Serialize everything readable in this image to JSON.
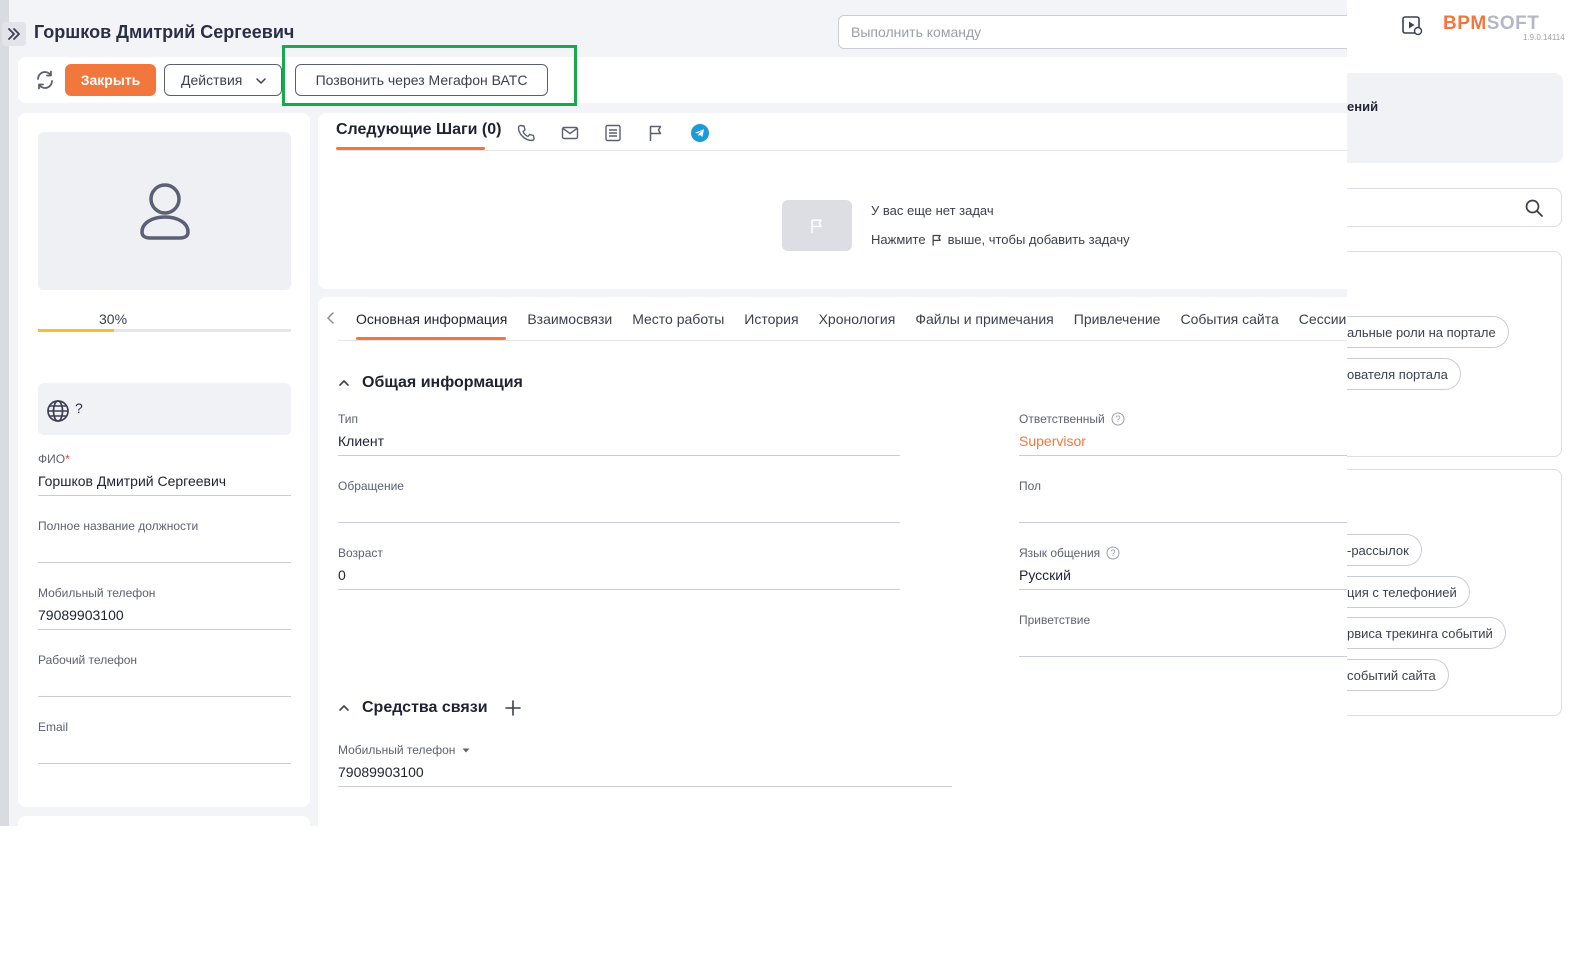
{
  "header": {
    "title": "Горшков Дмитрий Сергеевич",
    "command_placeholder": "Выполнить команду",
    "logo_brand": "BPM",
    "logo_soft": "SOFT",
    "version": "1.9.0.14114"
  },
  "toolbar": {
    "close_label": "Закрыть",
    "actions_label": "Действия",
    "call_label": "Позвонить через Мегафон ВАТС"
  },
  "profile": {
    "completeness": "30%",
    "completeness_fraction": 0.3,
    "timezone_value": "?",
    "fields": [
      {
        "label": "ФИО",
        "required": "*",
        "value": "Горшков Дмитрий Сергеевич"
      },
      {
        "label": "Полное название должности",
        "value": ""
      },
      {
        "label": "Мобильный телефон",
        "value": "79089903100"
      },
      {
        "label": "Рабочий телефон",
        "value": ""
      },
      {
        "label": "Email",
        "value": ""
      }
    ]
  },
  "next_steps": {
    "title": "Следующие Шаги (0)",
    "empty_title": "У вас еще нет задач",
    "empty_hint_before": "Нажмите",
    "empty_hint_after": "выше, чтобы добавить задачу"
  },
  "tabs": [
    {
      "label": "Основная информация"
    },
    {
      "label": "Взаимосвязи"
    },
    {
      "label": "Место работы"
    },
    {
      "label": "История"
    },
    {
      "label": "Хронология"
    },
    {
      "label": "Файлы и примечания"
    },
    {
      "label": "Привлечение"
    },
    {
      "label": "События сайта"
    },
    {
      "label": "Сесcии"
    }
  ],
  "general_info": {
    "section_title": "Общая информация",
    "type_label": "Тип",
    "type_value": "Клиент",
    "salutation_label": "Обращение",
    "salutation_value": "",
    "age_label": "Возраст",
    "age_value": "0",
    "owner_label": "Ответственный",
    "owner_value": "Supervisor",
    "gender_label": "Пол",
    "gender_value": "",
    "language_label": "Язык общения",
    "language_value": "Русский",
    "greeting_label": "Приветствие",
    "greeting_value": ""
  },
  "communication": {
    "section_title": "Средства связи",
    "mobile_label": "Мобильный телефон",
    "mobile_value": "79089903100"
  },
  "right_panel": {
    "title_fragment": "ений",
    "box1_chips": [
      "альные роли на портале",
      "ователя портала"
    ],
    "box2_chips": [
      "-рассылок",
      "ция с телефонией",
      "рвиса трекинга событий",
      "событий сайта"
    ]
  },
  "colors": {
    "accent": "#f2773c",
    "progress": "#f5c02c",
    "highlight": "#19a84b",
    "telegram": "#1d9bd6"
  }
}
